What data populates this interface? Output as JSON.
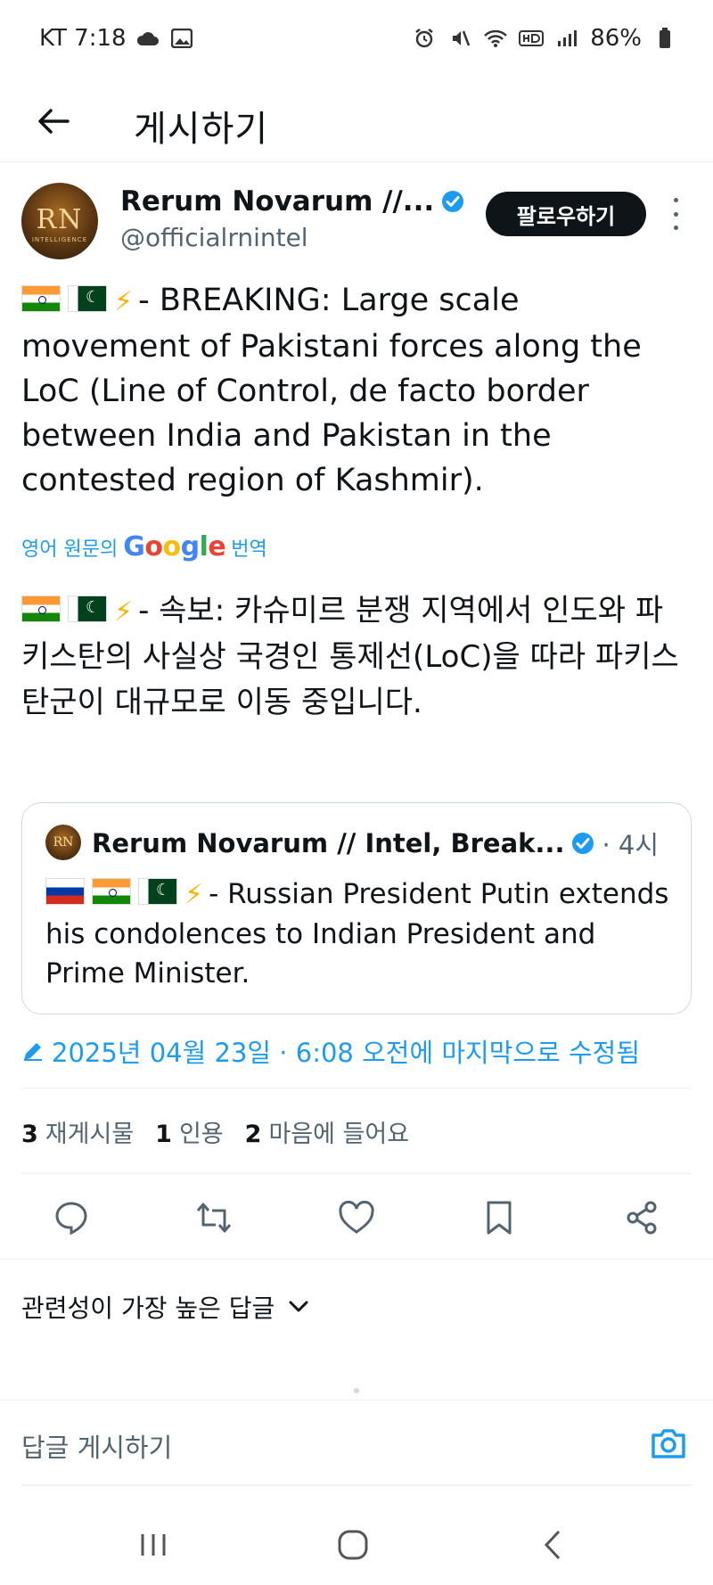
{
  "status_bar": {
    "carrier_time": "KT 7:18",
    "battery": "86%"
  },
  "header": {
    "title": "게시하기"
  },
  "post": {
    "author_name": "Rerum Novarum //...",
    "handle": "@officialrnintel",
    "follow_label": "팔로우하기",
    "avatar_text": "RN",
    "avatar_subtext": "INTELLIGENCE",
    "text": "- BREAKING: Large scale movement of Pakistani forces along the LoC (Line of Control, de facto border between India and Pakistan in the contested region of Kashmir).",
    "translate_prefix": "영어 원문의",
    "translate_suffix": "번역",
    "translated_text": "- 속보: 카슈미르 분쟁 지역에서 인도와 파키스탄의 사실상 국경인 통제선(LoC)을 따라 파키스탄군이 대규모로 이동 중입니다.",
    "edited": "2025년 04월 23일 · 6:08 오전에 마지막으로 수정됨"
  },
  "quote": {
    "avatar_text": "RN",
    "name": "Rerum Novarum // Intel, Break...",
    "time": "· 4시",
    "text": "- Russian President Putin extends his condolences to Indian President and Prime Minister."
  },
  "stats": {
    "reposts_count": "3",
    "reposts_label": "재게시물",
    "quotes_count": "1",
    "quotes_label": "인용",
    "likes_count": "2",
    "likes_label": "마음에 들어요"
  },
  "replies": {
    "sort_label": "관련성이 가장 높은 답글",
    "input_placeholder": "답글 게시하기"
  },
  "colors": {
    "accent": "#1d9bf0",
    "text": "#0f1419",
    "muted": "#536471"
  }
}
